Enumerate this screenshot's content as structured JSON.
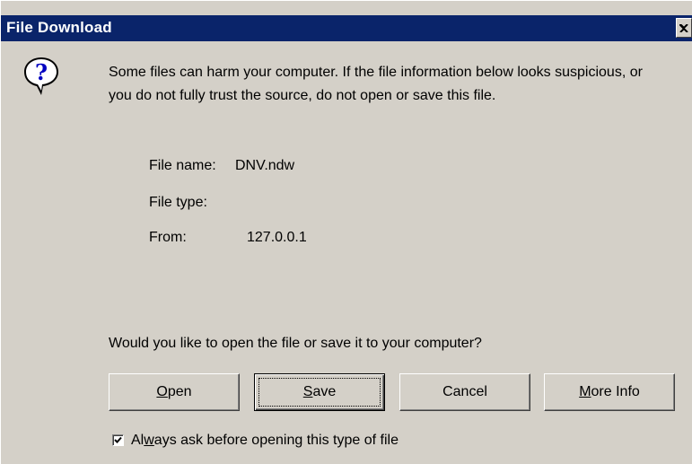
{
  "window": {
    "title": "File Download",
    "close_icon": "close-icon"
  },
  "icon": {
    "name": "question-icon",
    "glyph": "?"
  },
  "message": "Some files can harm your computer. If the file information below looks suspicious, or you do not fully trust the source, do not open or save this file.",
  "file_info": {
    "name_label": "File name:",
    "name_value": "DNV.ndw",
    "type_label": "File type:",
    "type_value": "",
    "from_label": "From:",
    "from_value": "127.0.0.1"
  },
  "question": "Would you like to open the file or save it to your computer?",
  "buttons": {
    "open": {
      "mnemonic": "O",
      "rest": "pen"
    },
    "save": {
      "mnemonic": "S",
      "rest": "ave"
    },
    "cancel": "Cancel",
    "more_info": {
      "mnemonic": "M",
      "rest": "ore Info"
    }
  },
  "always_ask": {
    "checked": true,
    "pre": "Al",
    "mnemonic": "w",
    "rest": "ays ask before opening this type of file"
  },
  "colors": {
    "titlebar": "#0a246a",
    "face": "#d4d0c8"
  }
}
